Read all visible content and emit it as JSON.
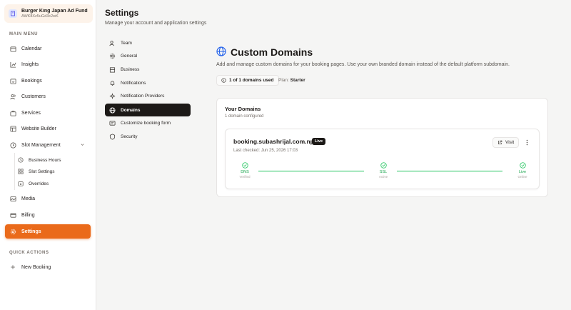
{
  "sidebar": {
    "org_name": "Burger King Japan Ad Fund",
    "org_id": "AWK8Xz5uGd3c2wK",
    "main_menu_title": "MAIN MENU",
    "items": [
      {
        "label": "Calendar"
      },
      {
        "label": "Insights"
      },
      {
        "label": "Bookings"
      },
      {
        "label": "Customers"
      },
      {
        "label": "Services"
      },
      {
        "label": "Website Builder"
      },
      {
        "label": "Slot Management"
      },
      {
        "label": "Media"
      },
      {
        "label": "Billing"
      },
      {
        "label": "Settings"
      }
    ],
    "slot_sub_items": [
      {
        "label": "Business Hours"
      },
      {
        "label": "Slot Settings"
      },
      {
        "label": "Overrides"
      }
    ],
    "quick_actions_title": "QUICK ACTIONS",
    "new_booking_label": "New Booking"
  },
  "header": {
    "title": "Settings",
    "subtitle": "Manage your account and application settings"
  },
  "settings_nav": [
    {
      "label": "Team"
    },
    {
      "label": "General"
    },
    {
      "label": "Business"
    },
    {
      "label": "Notifications"
    },
    {
      "label": "Notification Providers"
    },
    {
      "label": "Domains"
    },
    {
      "label": "Customize booking form"
    },
    {
      "label": "Security"
    }
  ],
  "custom_domains": {
    "title": "Custom Domains",
    "description": "Add and manage custom domains for your booking pages. Use your own branded domain instead of the default platform subdomain.",
    "usage": "1 of 1 domains used",
    "plan_label": "Plan:",
    "plan_value": "Starter"
  },
  "your_domains": {
    "title": "Your Domains",
    "count_text": "1 domain configured",
    "domain": {
      "name": "booking.subashrijal.com.np",
      "badge": "Live",
      "last_checked": "Last checked: Jun 25, 2026 17:03",
      "visit_label": "Visit",
      "steps": [
        {
          "label": "DNS",
          "status": "Verified"
        },
        {
          "label": "SSL",
          "status": "Active"
        },
        {
          "label": "Live",
          "status": "Online"
        }
      ]
    }
  },
  "colors": {
    "accent": "#ea6a1a",
    "active_nav": "#1c1917",
    "success": "#22c55e",
    "brand_blue": "#2563eb"
  }
}
